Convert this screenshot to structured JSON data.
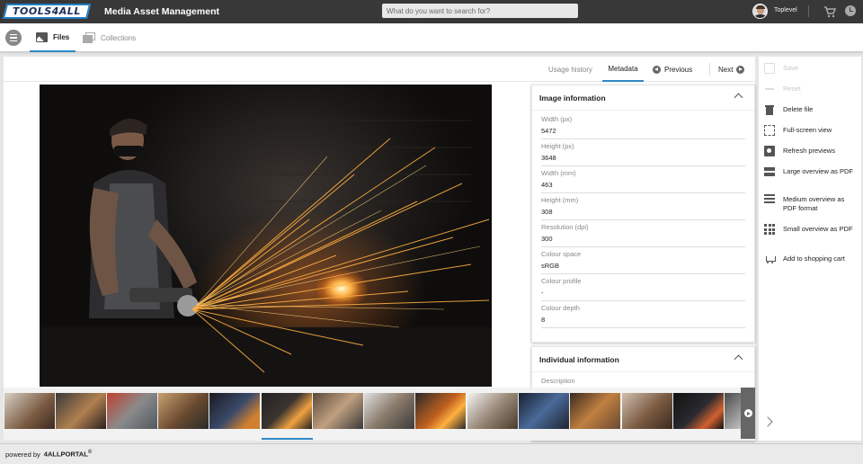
{
  "header": {
    "logo_text": "TOOLS4ALL",
    "app_title": "Media Asset Management",
    "search_placeholder": "What do you want to search for?",
    "username": "Toplevel"
  },
  "nav": {
    "tabs": [
      {
        "label": "Files",
        "active": true
      },
      {
        "label": "Collections",
        "active": false
      }
    ]
  },
  "toolbar": {
    "usage_history": "Usage history",
    "metadata": "Metadata",
    "previous": "Previous",
    "next": "Next"
  },
  "image_information": {
    "title": "Image information",
    "fields": [
      {
        "label": "Width (px)",
        "value": "5472"
      },
      {
        "label": "Height (px)",
        "value": "3648"
      },
      {
        "label": "Width (mm)",
        "value": "463"
      },
      {
        "label": "Height (mm)",
        "value": "308"
      },
      {
        "label": "Resolution (dpi)",
        "value": "300"
      },
      {
        "label": "Colour space",
        "value": "sRGB"
      },
      {
        "label": "Colour profile",
        "value": "-"
      },
      {
        "label": "Colour depth",
        "value": "8"
      }
    ]
  },
  "individual_information": {
    "title": "Individual information",
    "fields": [
      {
        "label": "Description",
        "value": ""
      }
    ]
  },
  "actions": [
    {
      "label": "Save",
      "icon": "save-icon",
      "enabled": false
    },
    {
      "label": "Reset",
      "icon": "reset-icon",
      "enabled": false
    },
    {
      "label": "Delete file",
      "icon": "trash-icon",
      "enabled": true
    },
    {
      "label": "Full-screen view",
      "icon": "fullscreen-icon",
      "enabled": true
    },
    {
      "label": "Refresh previews",
      "icon": "refresh-image-icon",
      "enabled": true
    },
    {
      "label": "Large overview as PDF",
      "icon": "large-list-icon",
      "enabled": true
    },
    {
      "label": "Medium overview as PDF format",
      "icon": "medium-list-icon",
      "enabled": true
    },
    {
      "label": "Small overview as PDF",
      "icon": "grid-icon",
      "enabled": true
    },
    {
      "label": "Add to shopping cart",
      "icon": "add-cart-icon",
      "enabled": true
    }
  ],
  "thumbnails": {
    "count": 15,
    "active_index": 5
  },
  "footer": {
    "powered_by": "powered by",
    "brand": "4ALLPORTAL",
    "brand_mark": "©"
  },
  "colors": {
    "accent": "#2e8ac7",
    "header_bg": "#383838",
    "logo_border": "#1f7ec2"
  }
}
